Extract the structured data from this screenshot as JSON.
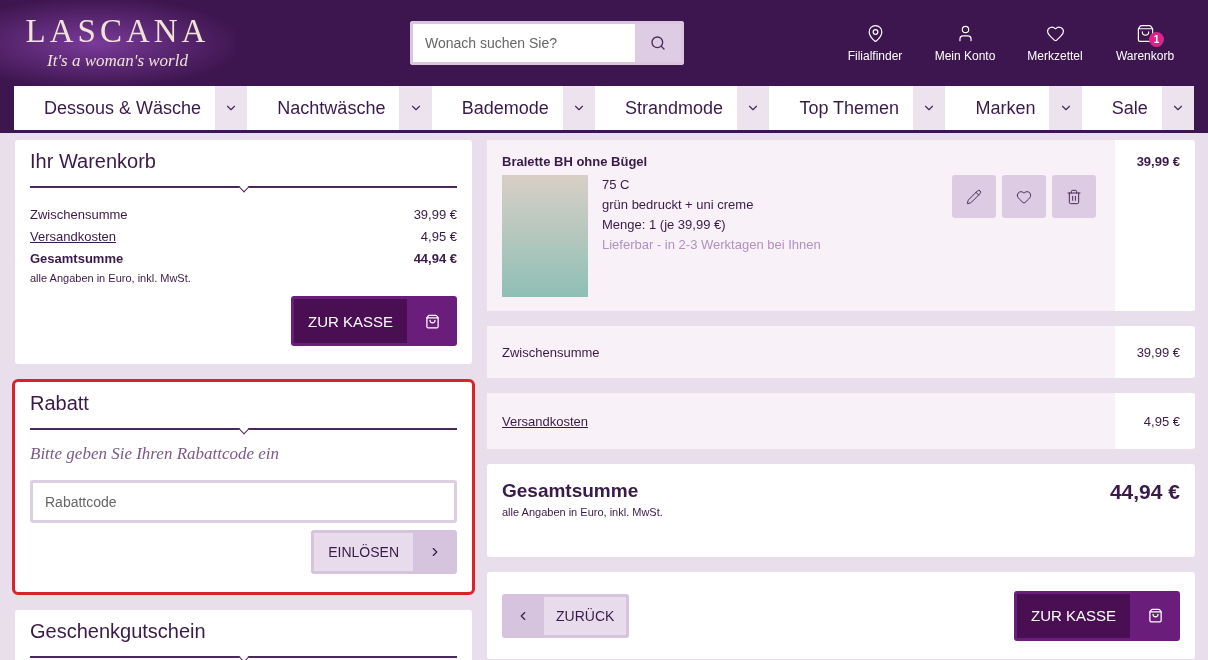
{
  "header": {
    "logo": {
      "name": "LASCANA",
      "tagline": "It's a woman's world"
    },
    "search": {
      "placeholder": "Wonach suchen Sie?"
    },
    "actions": [
      {
        "label": "Filialfinder",
        "kind": "pin"
      },
      {
        "label": "Mein Konto",
        "kind": "person"
      },
      {
        "label": "Merkzettel",
        "kind": "heart"
      },
      {
        "label": "Warenkorb",
        "kind": "bag",
        "badge": "1"
      }
    ]
  },
  "nav": [
    {
      "label": "Dessous & Wäsche"
    },
    {
      "label": "Nachtwäsche"
    },
    {
      "label": "Bademode"
    },
    {
      "label": "Strandmode"
    },
    {
      "label": "Top Themen"
    },
    {
      "label": "Marken"
    },
    {
      "label": "Sale"
    }
  ],
  "cart_summary": {
    "title": "Ihr Warenkorb",
    "rows": [
      {
        "label": "Zwischensumme",
        "value": "39,99 €",
        "kind": "plain"
      },
      {
        "label": "Versandkosten",
        "value": "4,95 €",
        "kind": "link"
      },
      {
        "label": "Gesamtsumme",
        "value": "44,94 €",
        "kind": "total"
      }
    ],
    "note": "alle Angaben in Euro, inkl. MwSt.",
    "checkout_button": "ZUR KASSE"
  },
  "discount": {
    "title": "Rabatt",
    "highlighted": true,
    "prompt": "Bitte geben Sie Ihren Rabattcode ein",
    "placeholder": "Rabattcode",
    "button": "EINLÖSEN"
  },
  "gift_card": {
    "title": "Geschenkgutschein"
  },
  "product": {
    "name": "Bralette BH ohne Bügel",
    "price": "39,99 €",
    "details": [
      "75 C",
      "grün bedruckt + uni creme",
      "Menge: 1 (je 39,99 €)"
    ],
    "availability": "Lieferbar - in 2-3 Werktagen bei Ihnen"
  },
  "totals": {
    "rows": [
      {
        "label": "Zwischensumme",
        "value": "39,99 €",
        "kind": "plain"
      },
      {
        "label": "Versandkosten",
        "value": "4,95 €",
        "kind": "link"
      }
    ],
    "grand_total": {
      "label": "Gesamtsumme",
      "value": "44,94 €",
      "note": "alle Angaben in Euro, inkl. MwSt."
    }
  },
  "footer_buttons": {
    "back": "ZURÜCK",
    "checkout": "ZUR KASSE"
  }
}
